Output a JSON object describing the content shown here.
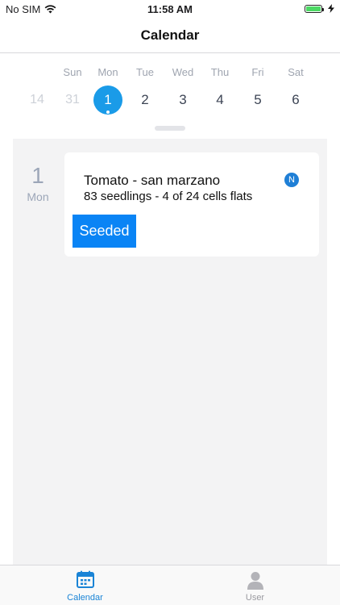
{
  "status_bar": {
    "carrier": "No SIM",
    "time": "11:58 AM",
    "battery_level": 1.0,
    "battery_color": "#4cd964"
  },
  "nav": {
    "title": "Calendar"
  },
  "week": {
    "days": [
      {
        "name": "",
        "number": "14",
        "muted": true,
        "selected": false
      },
      {
        "name": "Sun",
        "number": "31",
        "muted": true,
        "selected": false
      },
      {
        "name": "Mon",
        "number": "1",
        "muted": false,
        "selected": true
      },
      {
        "name": "Tue",
        "number": "2",
        "muted": false,
        "selected": false
      },
      {
        "name": "Wed",
        "number": "3",
        "muted": false,
        "selected": false
      },
      {
        "name": "Thu",
        "number": "4",
        "muted": false,
        "selected": false
      },
      {
        "name": "Fri",
        "number": "5",
        "muted": false,
        "selected": false
      },
      {
        "name": "Sat",
        "number": "6",
        "muted": false,
        "selected": false
      }
    ],
    "selected_color": "#1a9be8"
  },
  "agenda": {
    "day_number": "1",
    "day_name": "Mon",
    "event": {
      "title": "Tomato - san marzano",
      "subtitle": "83 seedlings - 4 of 24 cells flats",
      "badge": "N",
      "badge_color": "#1f7fd6",
      "status": "Seeded",
      "status_color": "#0a84f5"
    }
  },
  "tab_bar": {
    "tabs": [
      {
        "label": "Calendar",
        "icon": "calendar-icon",
        "active": true
      },
      {
        "label": "User",
        "icon": "user-icon",
        "active": false
      }
    ],
    "active_color": "#1a84d6"
  }
}
